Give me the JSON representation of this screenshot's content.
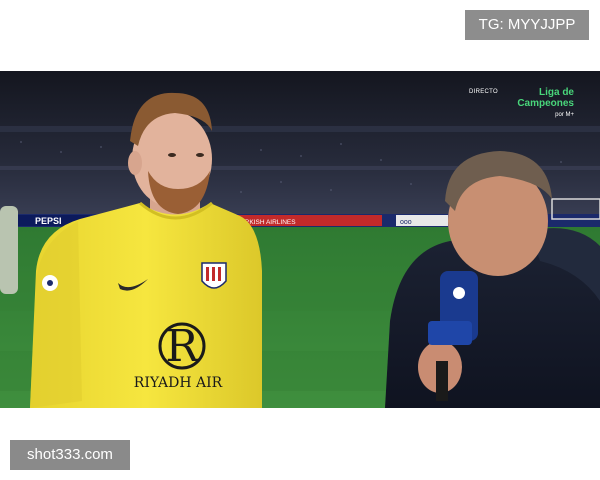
{
  "watermarks": {
    "top_right": "TG: MYYJJPP",
    "bottom_left": "shot333.com"
  },
  "broadcast": {
    "live_label": "DIRECTO",
    "competition": "Liga de\nCampeones",
    "channel": "por M+"
  },
  "ads": {
    "left": "PEPSI",
    "middle": "TURKISH AIRLINES",
    "right": "ooo"
  },
  "shirt": {
    "sponsor": "RIYADH AIR"
  },
  "colors": {
    "shirt": "#f2e23a",
    "pitch": "#3c8a3a",
    "accent": "#49d67b"
  }
}
